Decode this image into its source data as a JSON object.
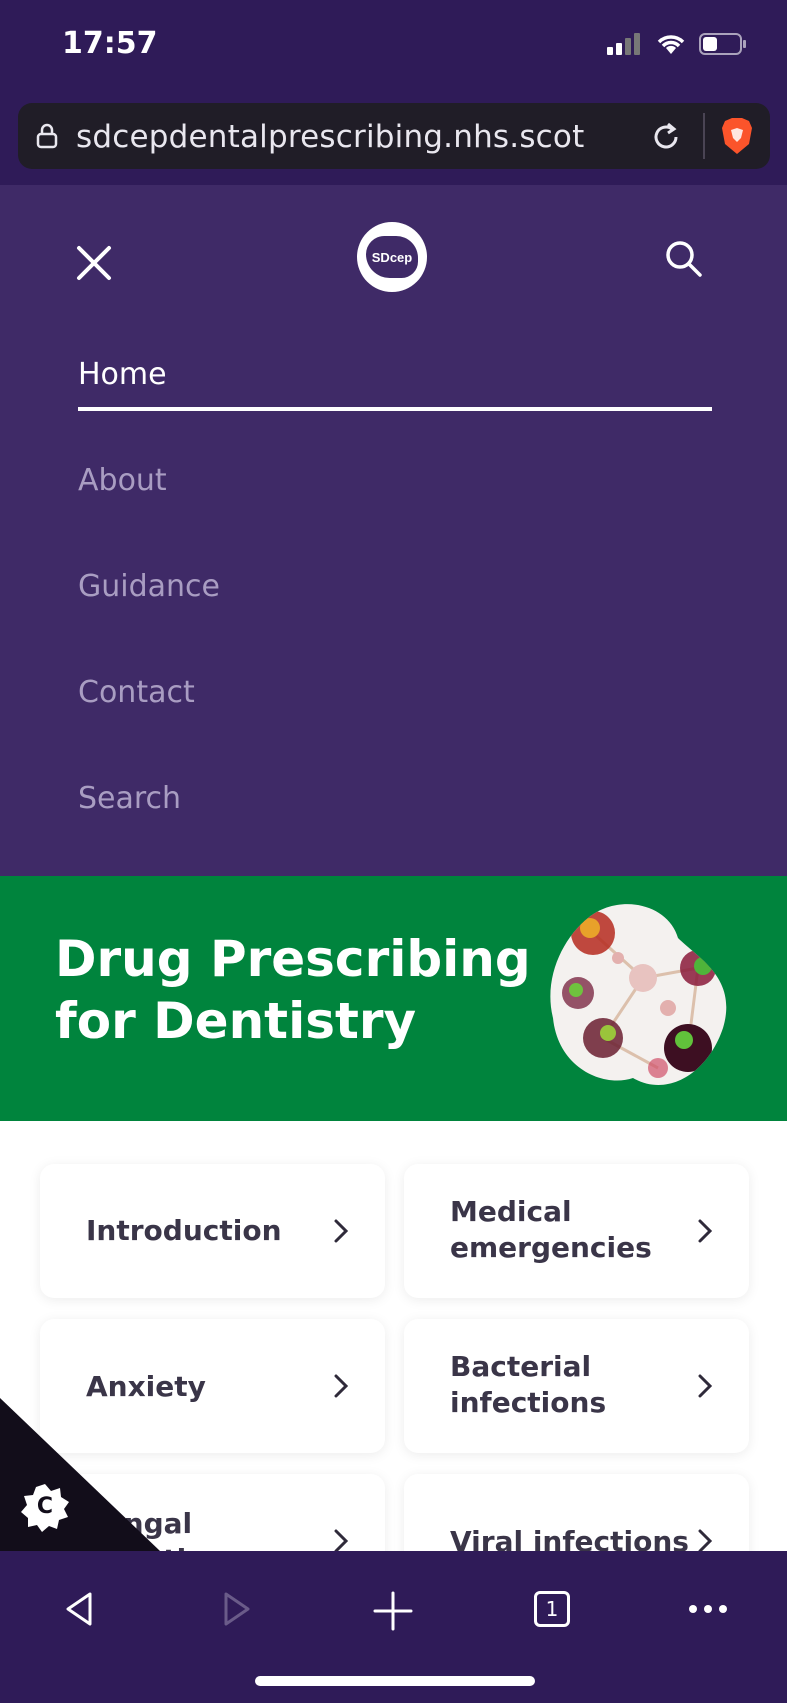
{
  "status": {
    "time": "17:57"
  },
  "browser": {
    "url": "sdcepdentalprescribing.nhs.scot",
    "tab_count": "1"
  },
  "menu": {
    "logo_text": "SDcep",
    "items": [
      {
        "label": "Home",
        "active": true
      },
      {
        "label": "About"
      },
      {
        "label": "Guidance"
      },
      {
        "label": "Contact"
      },
      {
        "label": "Search"
      }
    ]
  },
  "hero": {
    "title": "Drug Prescribing for Dentistry"
  },
  "cards": [
    {
      "label": "Introduction"
    },
    {
      "label": "Medical emergencies"
    },
    {
      "label": "Anxiety"
    },
    {
      "label": "Bacterial infections"
    },
    {
      "label": "Fungal infections"
    },
    {
      "label": "Viral infections"
    }
  ],
  "cookie": {
    "icon_letter": "C"
  },
  "colors": {
    "header": "#3f2a67",
    "hero": "#00843d",
    "browser_chrome": "#2f1b58"
  }
}
